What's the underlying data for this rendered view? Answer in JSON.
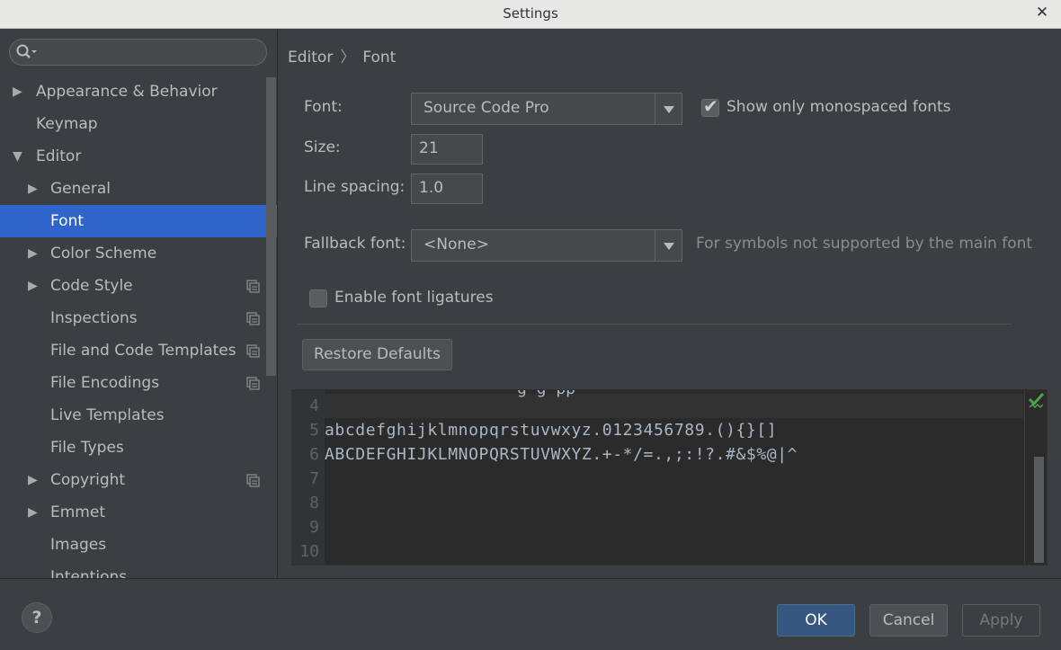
{
  "window": {
    "title": "Settings",
    "close_glyph": "✕"
  },
  "search": {
    "placeholder": "",
    "icon": "search-icon"
  },
  "sidebar": {
    "items": [
      {
        "label": "Appearance & Behavior",
        "expander": "collapsed"
      },
      {
        "label": "Keymap",
        "expander": "none"
      },
      {
        "label": "Editor",
        "expander": "expanded"
      },
      {
        "label": "General",
        "expander": "collapsed"
      },
      {
        "label": "Font",
        "expander": "none",
        "selected": true
      },
      {
        "label": "Color Scheme",
        "expander": "collapsed"
      },
      {
        "label": "Code Style",
        "expander": "collapsed",
        "project_icon": true
      },
      {
        "label": "Inspections",
        "expander": "none",
        "project_icon": true
      },
      {
        "label": "File and Code Templates",
        "expander": "none",
        "project_icon": true
      },
      {
        "label": "File Encodings",
        "expander": "none",
        "project_icon": true
      },
      {
        "label": "Live Templates",
        "expander": "none"
      },
      {
        "label": "File Types",
        "expander": "none"
      },
      {
        "label": "Copyright",
        "expander": "collapsed",
        "project_icon": true
      },
      {
        "label": "Emmet",
        "expander": "collapsed"
      },
      {
        "label": "Images",
        "expander": "none"
      },
      {
        "label": "Intentions",
        "expander": "none"
      }
    ]
  },
  "breadcrumb": {
    "parent": "Editor",
    "separator": "〉",
    "current": "Font"
  },
  "font_settings": {
    "font_label": "Font:",
    "font_value": "Source Code Pro",
    "mono_only_label": "Show only monospaced fonts",
    "mono_only_checked": true,
    "size_label": "Size:",
    "size_value": "21",
    "line_spacing_label": "Line spacing:",
    "line_spacing_value": "1.0",
    "fallback_label": "Fallback font:",
    "fallback_value": "<None>",
    "fallback_hint": "For symbols not supported by the main font",
    "ligatures_label": "Enable font ligatures",
    "ligatures_checked": false,
    "restore_label": "Restore Defaults"
  },
  "preview": {
    "line_numbers": [
      "4",
      "5",
      "6",
      "7",
      "8",
      "9",
      "10"
    ],
    "line5": "abcdefghijklmnopqrstuvwxyz.0123456789.(){}[]",
    "line6": "ABCDEFGHIJKLMNOPQRSTUVWXYZ.+-*/=.,;:!?.#&$%@|^",
    "clipped_line": "g       g  pp"
  },
  "footer": {
    "help_label": "?",
    "ok_label": "OK",
    "cancel_label": "Cancel",
    "apply_label": "Apply"
  },
  "colors": {
    "background": "#3c3f41",
    "selection": "#2f65ca",
    "editor_bg": "#2b2b2b",
    "primary_button": "#365880"
  }
}
